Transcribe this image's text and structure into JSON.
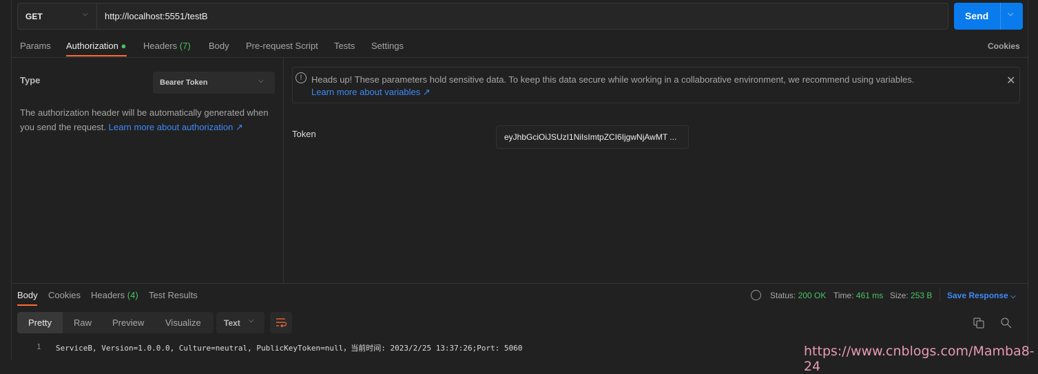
{
  "request": {
    "method": "GET",
    "url": "http://localhost:5551/testB",
    "send_label": "Send"
  },
  "tabs": {
    "params": "Params",
    "authorization": "Authorization",
    "headers": "Headers",
    "headers_count": "(7)",
    "body": "Body",
    "prerequest": "Pre-request Script",
    "tests": "Tests",
    "settings": "Settings",
    "cookies": "Cookies"
  },
  "auth": {
    "type_label": "Type",
    "type_value": "Bearer Token",
    "description": "The authorization header will be automatically generated when you send the request.",
    "learn_more": "Learn more about authorization ↗",
    "notice": "Heads up! These parameters hold sensitive data. To keep this data secure while working in a collaborative environment, we recommend using variables.",
    "notice_link": "Learn more about variables ↗",
    "token_label": "Token",
    "token_value": "eyJhbGciOiJSUzI1NiIsImtpZCI6IjgwNjAwMT ..."
  },
  "response": {
    "tabs": {
      "body": "Body",
      "cookies": "Cookies",
      "headers": "Headers",
      "headers_count": "(4)",
      "test_results": "Test Results"
    },
    "status_label": "Status:",
    "status": "200 OK",
    "time_label": "Time:",
    "time": "461 ms",
    "size_label": "Size:",
    "size": "253 B",
    "save": "Save Response",
    "views": [
      "Pretty",
      "Raw",
      "Preview",
      "Visualize"
    ],
    "format": "Text",
    "lines": [
      {
        "num": "1",
        "text": "ServiceB, Version=1.0.0.0, Culture=neutral, PublicKeyToken=null，当前时间: 2023/2/25 13:37:26;Port: 5060"
      }
    ]
  },
  "watermark": "https://www.cnblogs.com/Mamba8-24",
  "colors": {
    "accent": "#097bed",
    "active_tab": "#ff6c37",
    "green": "#49c463",
    "link": "#3d8af7"
  }
}
